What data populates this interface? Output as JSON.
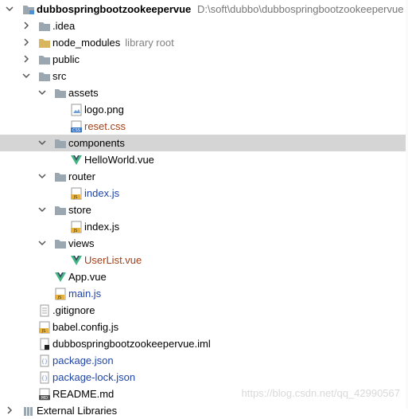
{
  "project": {
    "name": "dubbospringbootzookeepervue",
    "path": "D:\\soft\\dubbo\\dubbospringbootzookeepervue"
  },
  "tree": {
    "idea": ".idea",
    "node_modules": "node_modules",
    "node_modules_hint": "library root",
    "public": "public",
    "src": "src",
    "assets": "assets",
    "logo": "logo.png",
    "reset": "reset.css",
    "components": "components",
    "helloworld": "HelloWorld.vue",
    "router": "router",
    "router_index": "index.js",
    "store": "store",
    "store_index": "index.js",
    "views": "views",
    "userlist": "UserList.vue",
    "app": "App.vue",
    "main": "main.js",
    "gitignore": ".gitignore",
    "babel": "babel.config.js",
    "iml": "dubbospringbootzookeepervue.iml",
    "package": "package.json",
    "package_lock": "package-lock.json",
    "readme": "README.md",
    "external": "External Libraries"
  },
  "watermark": "https://blog.csdn.net/qq_42990567",
  "colors": {
    "folder": "#9aa7b0",
    "selected_row": "#d5d5d5",
    "modified_blue": "#1f45a8",
    "vue_green": "#41b883"
  }
}
